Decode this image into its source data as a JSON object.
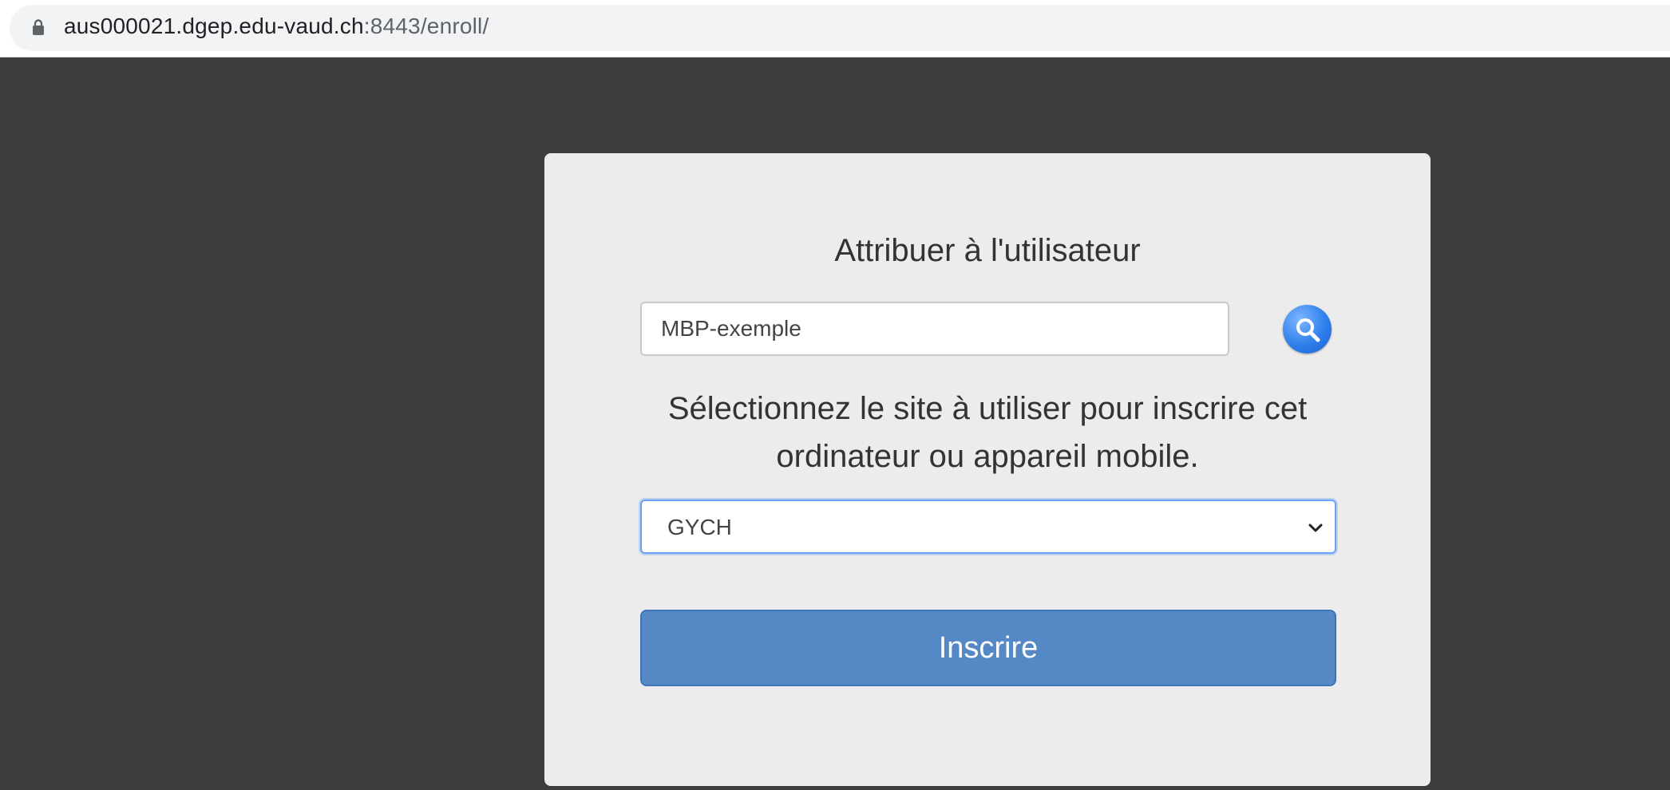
{
  "browser": {
    "url_host": "aus000021.dgep.edu-vaud.ch",
    "url_rest": ":8443/enroll/",
    "lock_icon": "lock-icon"
  },
  "form": {
    "title": "Attribuer à l'utilisateur",
    "user_value": "MBP-exemple",
    "search_icon": "search-icon",
    "prompt": "Sélectionnez le site à utiliser pour inscrire cet ordinateur ou appareil mobile.",
    "site_selected": "GYCH",
    "enroll_label": "Inscrire"
  },
  "colors": {
    "page_background": "#3d3d3d",
    "card_background": "#ececec",
    "button_primary": "#5589c6",
    "focus_ring": "#6aa3f0"
  }
}
